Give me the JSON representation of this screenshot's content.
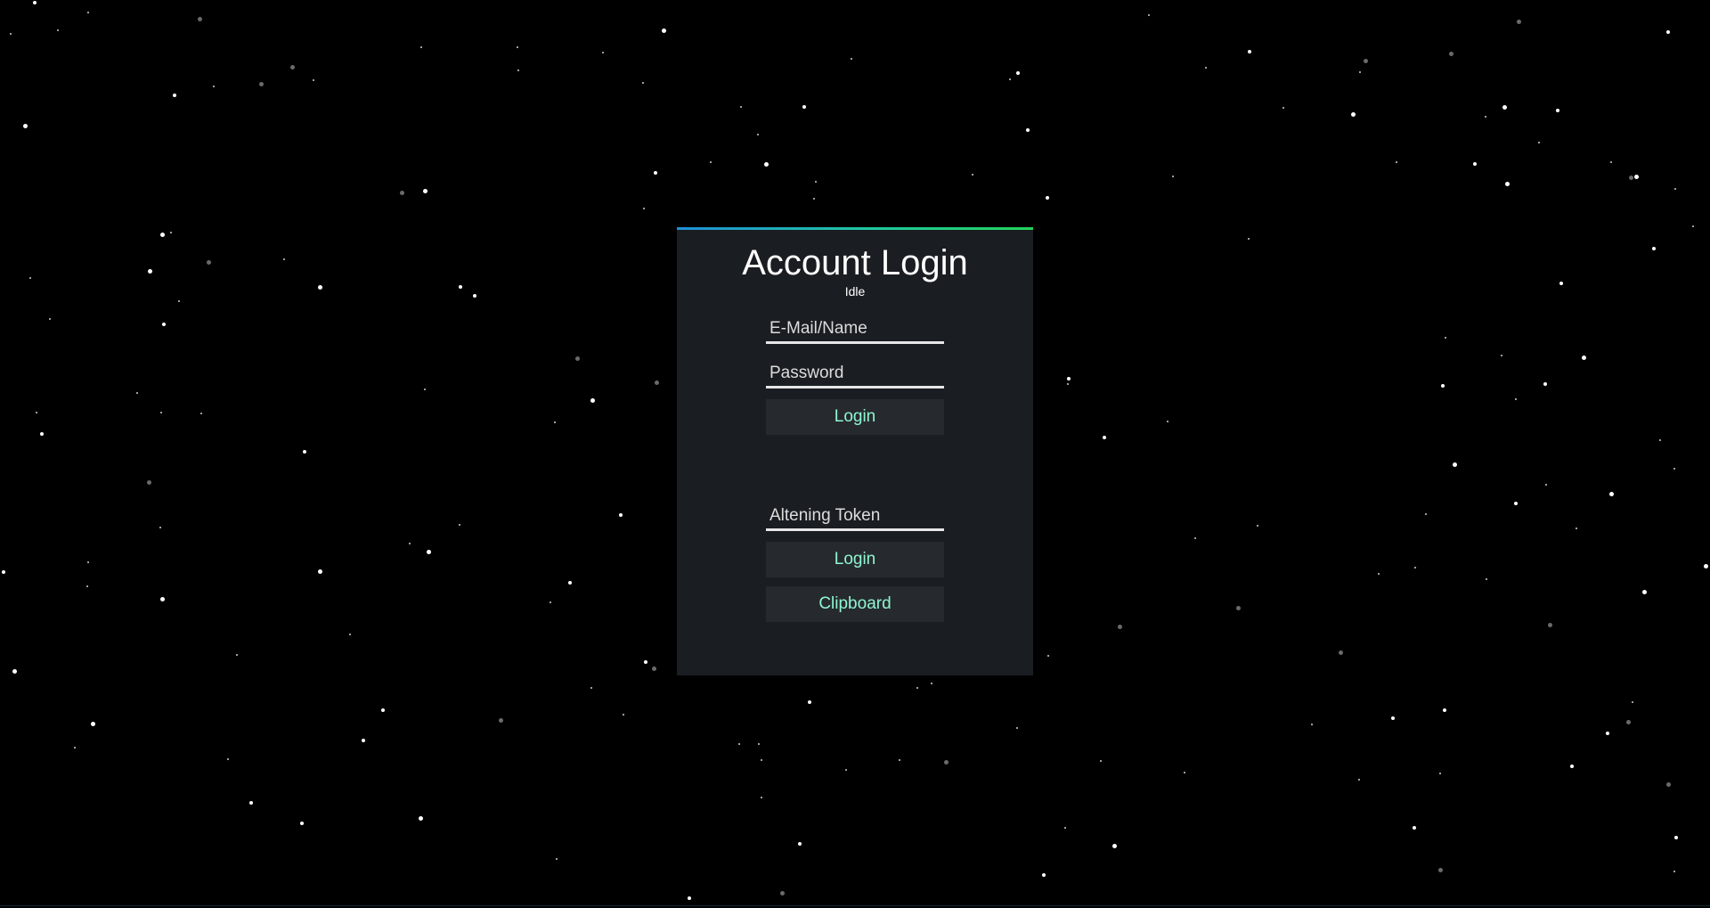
{
  "login": {
    "title": "Account Login",
    "status": "Idle",
    "email_placeholder": "E-Mail/Name",
    "password_placeholder": "Password",
    "login_label": "Login",
    "token_placeholder": "Altening Token",
    "token_login_label": "Login",
    "clipboard_label": "Clipboard"
  },
  "colors": {
    "background": "#000000",
    "panel": "#1a1d21",
    "button": "#262a2e",
    "button_text": "#8ff5cf",
    "accent_start": "#1f8fd6",
    "accent_end": "#22d35a"
  }
}
